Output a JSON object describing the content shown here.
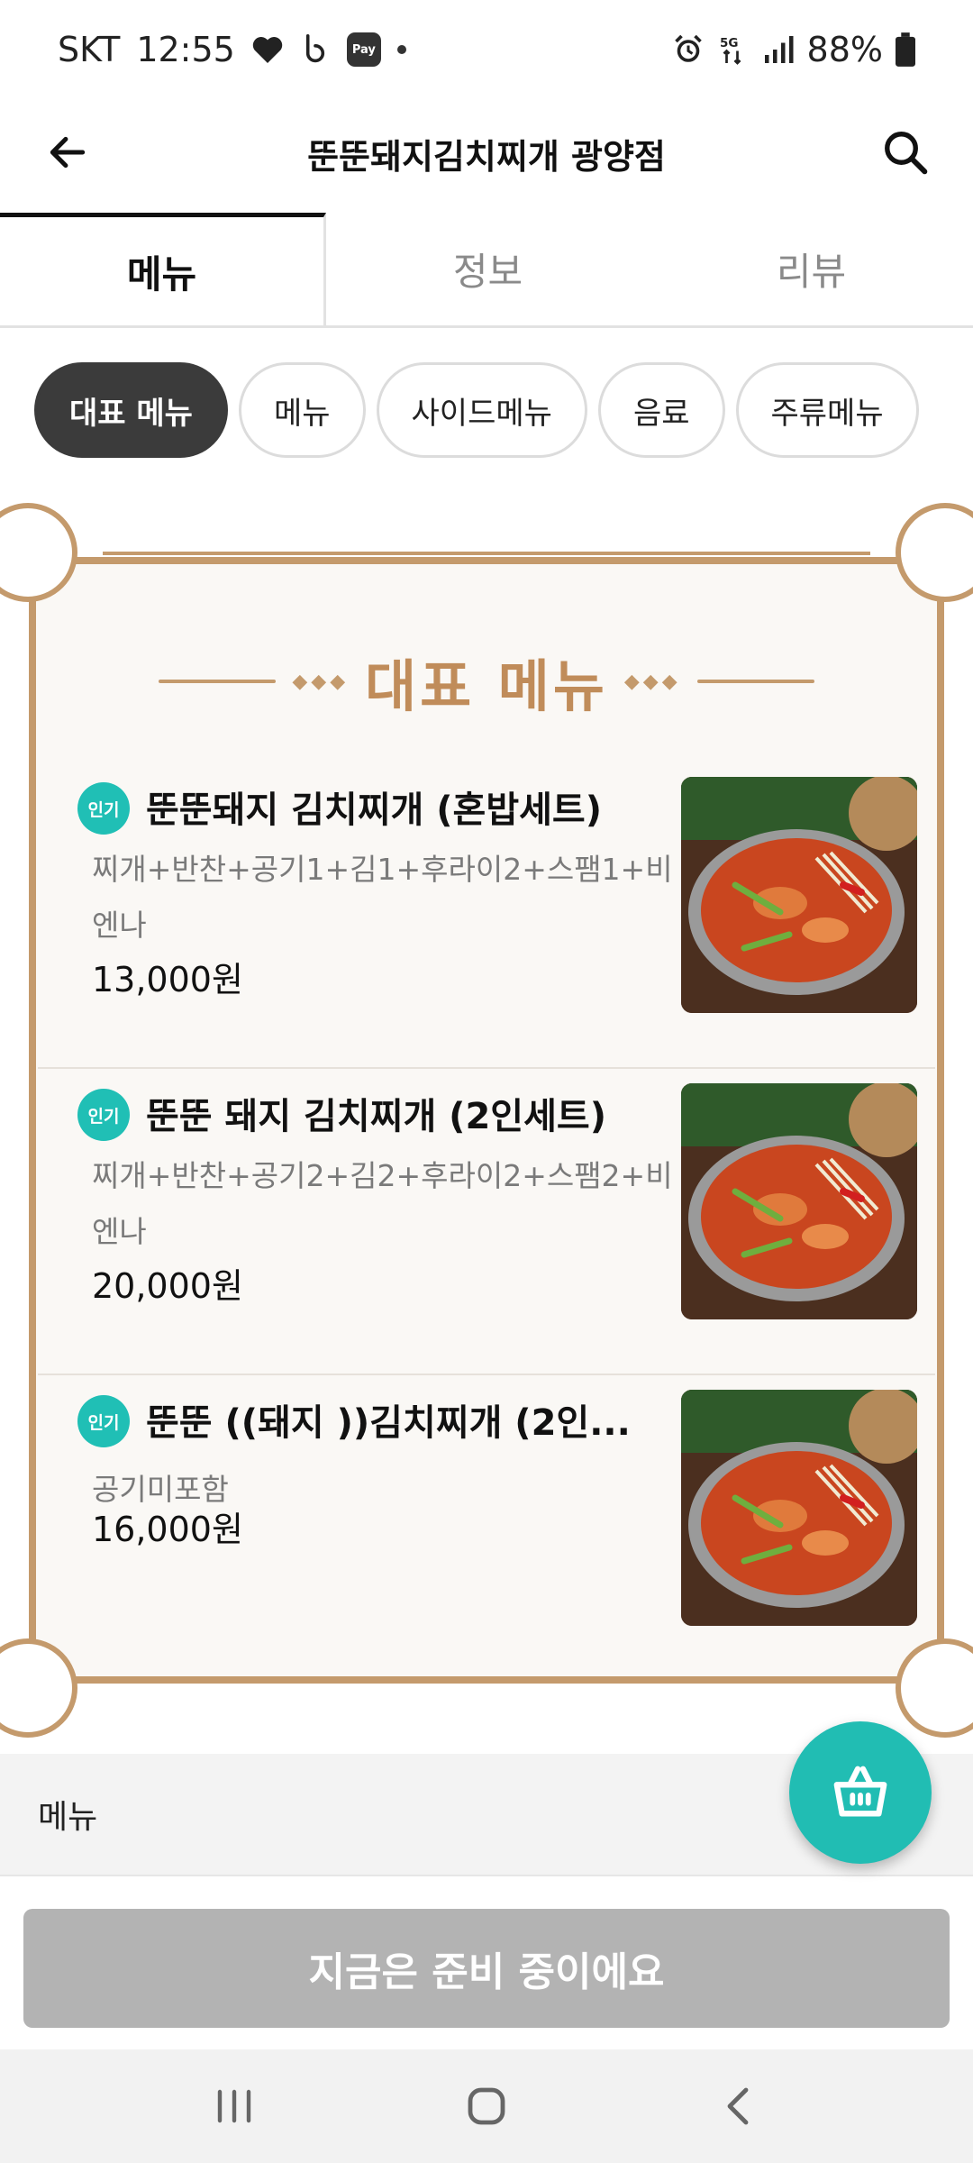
{
  "status_bar": {
    "carrier": "SKT",
    "time": "12:55",
    "pay_label": "Pay",
    "battery": "88%",
    "network": "5G"
  },
  "header": {
    "title": "뚠뚠돼지김치찌개 광양점"
  },
  "tabs": [
    {
      "label": "메뉴",
      "active": true
    },
    {
      "label": "정보",
      "active": false
    },
    {
      "label": "리뷰",
      "active": false
    }
  ],
  "chips": [
    {
      "label": "대표 메뉴",
      "active": true
    },
    {
      "label": "메뉴",
      "active": false
    },
    {
      "label": "사이드메뉴",
      "active": false
    },
    {
      "label": "음료",
      "active": false
    },
    {
      "label": "주류메뉴",
      "active": false
    }
  ],
  "board": {
    "title": "대표 메뉴",
    "items": [
      {
        "badge": "인기",
        "name": "뚠뚠돼지 김치찌개 (혼밥세트)",
        "description": "찌개+반찬+공기1+김1+후라이2+스팸1+비엔나",
        "price": "13,000원"
      },
      {
        "badge": "인기",
        "name": "뚠뚠 돼지 김치찌개 (2인세트)",
        "description": "찌개+반찬+공기2+김2+후라이2+스팸2+비엔나",
        "price": "20,000원"
      },
      {
        "badge": "인기",
        "name": "뚠뚠 ((돼지 ))김치찌개 (2인...",
        "description": "공기미포함",
        "price": "16,000원"
      }
    ]
  },
  "bottom": {
    "menu_label": "메뉴",
    "cta_label": "지금은 준비 중이에요"
  },
  "colors": {
    "accent_teal": "#21bdb3",
    "board_gold": "#c49a6c",
    "chip_active": "#3b3b3b",
    "cta_disabled": "#b3b3b3"
  },
  "icons": {
    "back": "arrow-left-icon",
    "search": "search-icon",
    "cart": "basket-icon",
    "nav_recent": "recent-apps-icon",
    "nav_home": "home-icon",
    "nav_back": "nav-back-icon"
  }
}
